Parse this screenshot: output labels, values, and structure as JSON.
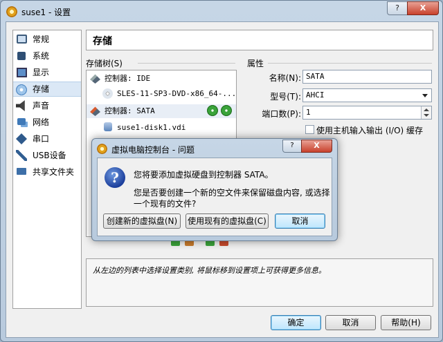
{
  "window": {
    "title": "suse1 - 设置",
    "help_btn": "?",
    "close_btn": "X"
  },
  "sidebar": {
    "items": [
      {
        "label": "常规",
        "icon": "monitor-icon"
      },
      {
        "label": "系统",
        "icon": "chip-icon"
      },
      {
        "label": "显示",
        "icon": "display-icon"
      },
      {
        "label": "存储",
        "icon": "storage-icon",
        "selected": true
      },
      {
        "label": "声音",
        "icon": "speaker-icon"
      },
      {
        "label": "网络",
        "icon": "network-icon"
      },
      {
        "label": "串口",
        "icon": "serial-icon"
      },
      {
        "label": "USB设备",
        "icon": "usb-icon"
      },
      {
        "label": "共享文件夹",
        "icon": "folder-icon"
      }
    ]
  },
  "page": {
    "title": "存储"
  },
  "storage_tree": {
    "label": "存储树(S)",
    "rows": [
      {
        "label": "控制器: IDE",
        "kind": "controller"
      },
      {
        "label": "SLES-11-SP3-DVD-x86_64-...",
        "kind": "optical"
      },
      {
        "label": "控制器: SATA",
        "kind": "controller",
        "selected": true
      },
      {
        "label": "suse1-disk1.vdi",
        "kind": "hdd"
      }
    ]
  },
  "attributes": {
    "label": "属性",
    "name_label": "名称(N):",
    "name_value": "SATA",
    "type_label": "型号(T):",
    "type_value": "AHCI",
    "ports_label": "端口数(P):",
    "ports_value": "1",
    "host_io_label": "使用主机输入输出 (I/O) 缓存"
  },
  "info": {
    "text": "从左边的列表中选择设置类别, 将鼠标移到设置项上可获得更多信息。"
  },
  "buttons": {
    "ok": "确定",
    "cancel": "取消",
    "help": "帮助(H)"
  },
  "dialog": {
    "title": "虚拟电脑控制台 - 问题",
    "help_btn": "?",
    "close_btn": "X",
    "message1": "您将要添加虚拟硬盘到控制器 SATA。",
    "message2": "您是否要创建一个新的空文件来保留磁盘内容, 或选择一个现有的文件?",
    "btn_new": "创建新的虚拟盘(N)",
    "btn_existing": "使用现有的虚拟盘(C)",
    "btn_cancel": "取消"
  },
  "colors": {
    "selection": "#dbe8f6",
    "default_button": "#bee6fd",
    "close_button": "#c8412c"
  }
}
